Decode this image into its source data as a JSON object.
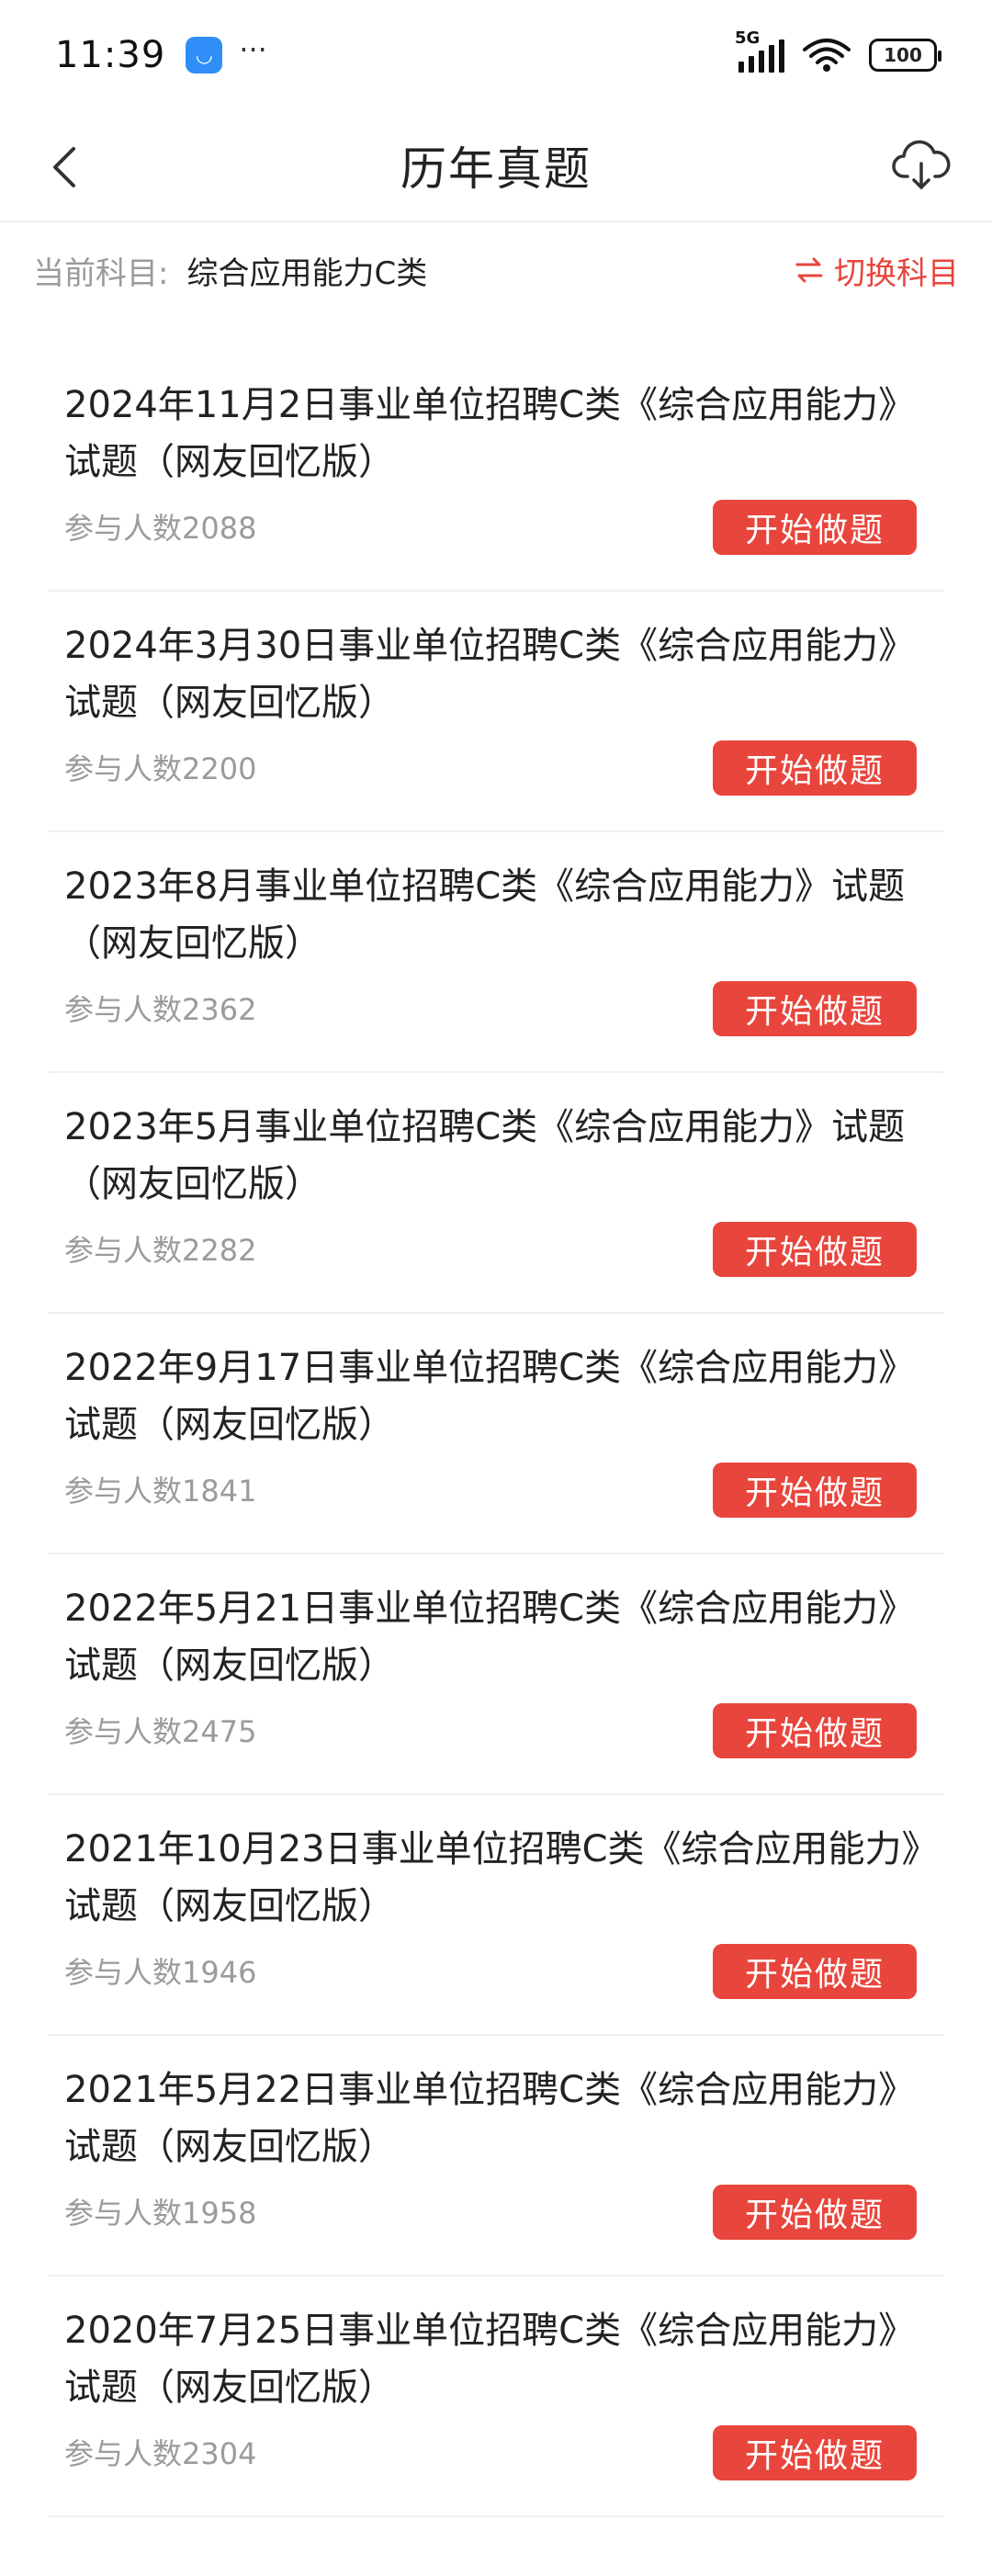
{
  "status_bar": {
    "time": "11:39",
    "more": "···",
    "network": "5G",
    "battery": "100"
  },
  "header": {
    "title": "历年真题",
    "back_icon": "chevron-left-icon",
    "download_icon": "cloud-download-icon"
  },
  "subject": {
    "label": "当前科目:",
    "value": "综合应用能力C类",
    "switch_label": "切换科目",
    "accent_color": "#e8453c"
  },
  "items": [
    {
      "title": "2024年11月2日事业单位招聘C类《综合应用能力》试题（网友回忆版）",
      "count": "参与人数2088",
      "button": "开始做题"
    },
    {
      "title": "2024年3月30日事业单位招聘C类《综合应用能力》试题（网友回忆版）",
      "count": "参与人数2200",
      "button": "开始做题"
    },
    {
      "title": "2023年8月事业单位招聘C类《综合应用能力》试题（网友回忆版）",
      "count": "参与人数2362",
      "button": "开始做题"
    },
    {
      "title": "2023年5月事业单位招聘C类《综合应用能力》试题（网友回忆版）",
      "count": "参与人数2282",
      "button": "开始做题"
    },
    {
      "title": "2022年9月17日事业单位招聘C类《综合应用能力》试题（网友回忆版）",
      "count": "参与人数1841",
      "button": "开始做题"
    },
    {
      "title": "2022年5月21日事业单位招聘C类《综合应用能力》试题（网友回忆版）",
      "count": "参与人数2475",
      "button": "开始做题"
    },
    {
      "title": "2021年10月23日事业单位招聘C类《综合应用能力》试题（网友回忆版）",
      "count": "参与人数1946",
      "button": "开始做题"
    },
    {
      "title": "2021年5月22日事业单位招聘C类《综合应用能力》试题（网友回忆版）",
      "count": "参与人数1958",
      "button": "开始做题"
    },
    {
      "title": "2020年7月25日事业单位招聘C类《综合应用能力》试题（网友回忆版）",
      "count": "参与人数2304",
      "button": "开始做题"
    }
  ]
}
